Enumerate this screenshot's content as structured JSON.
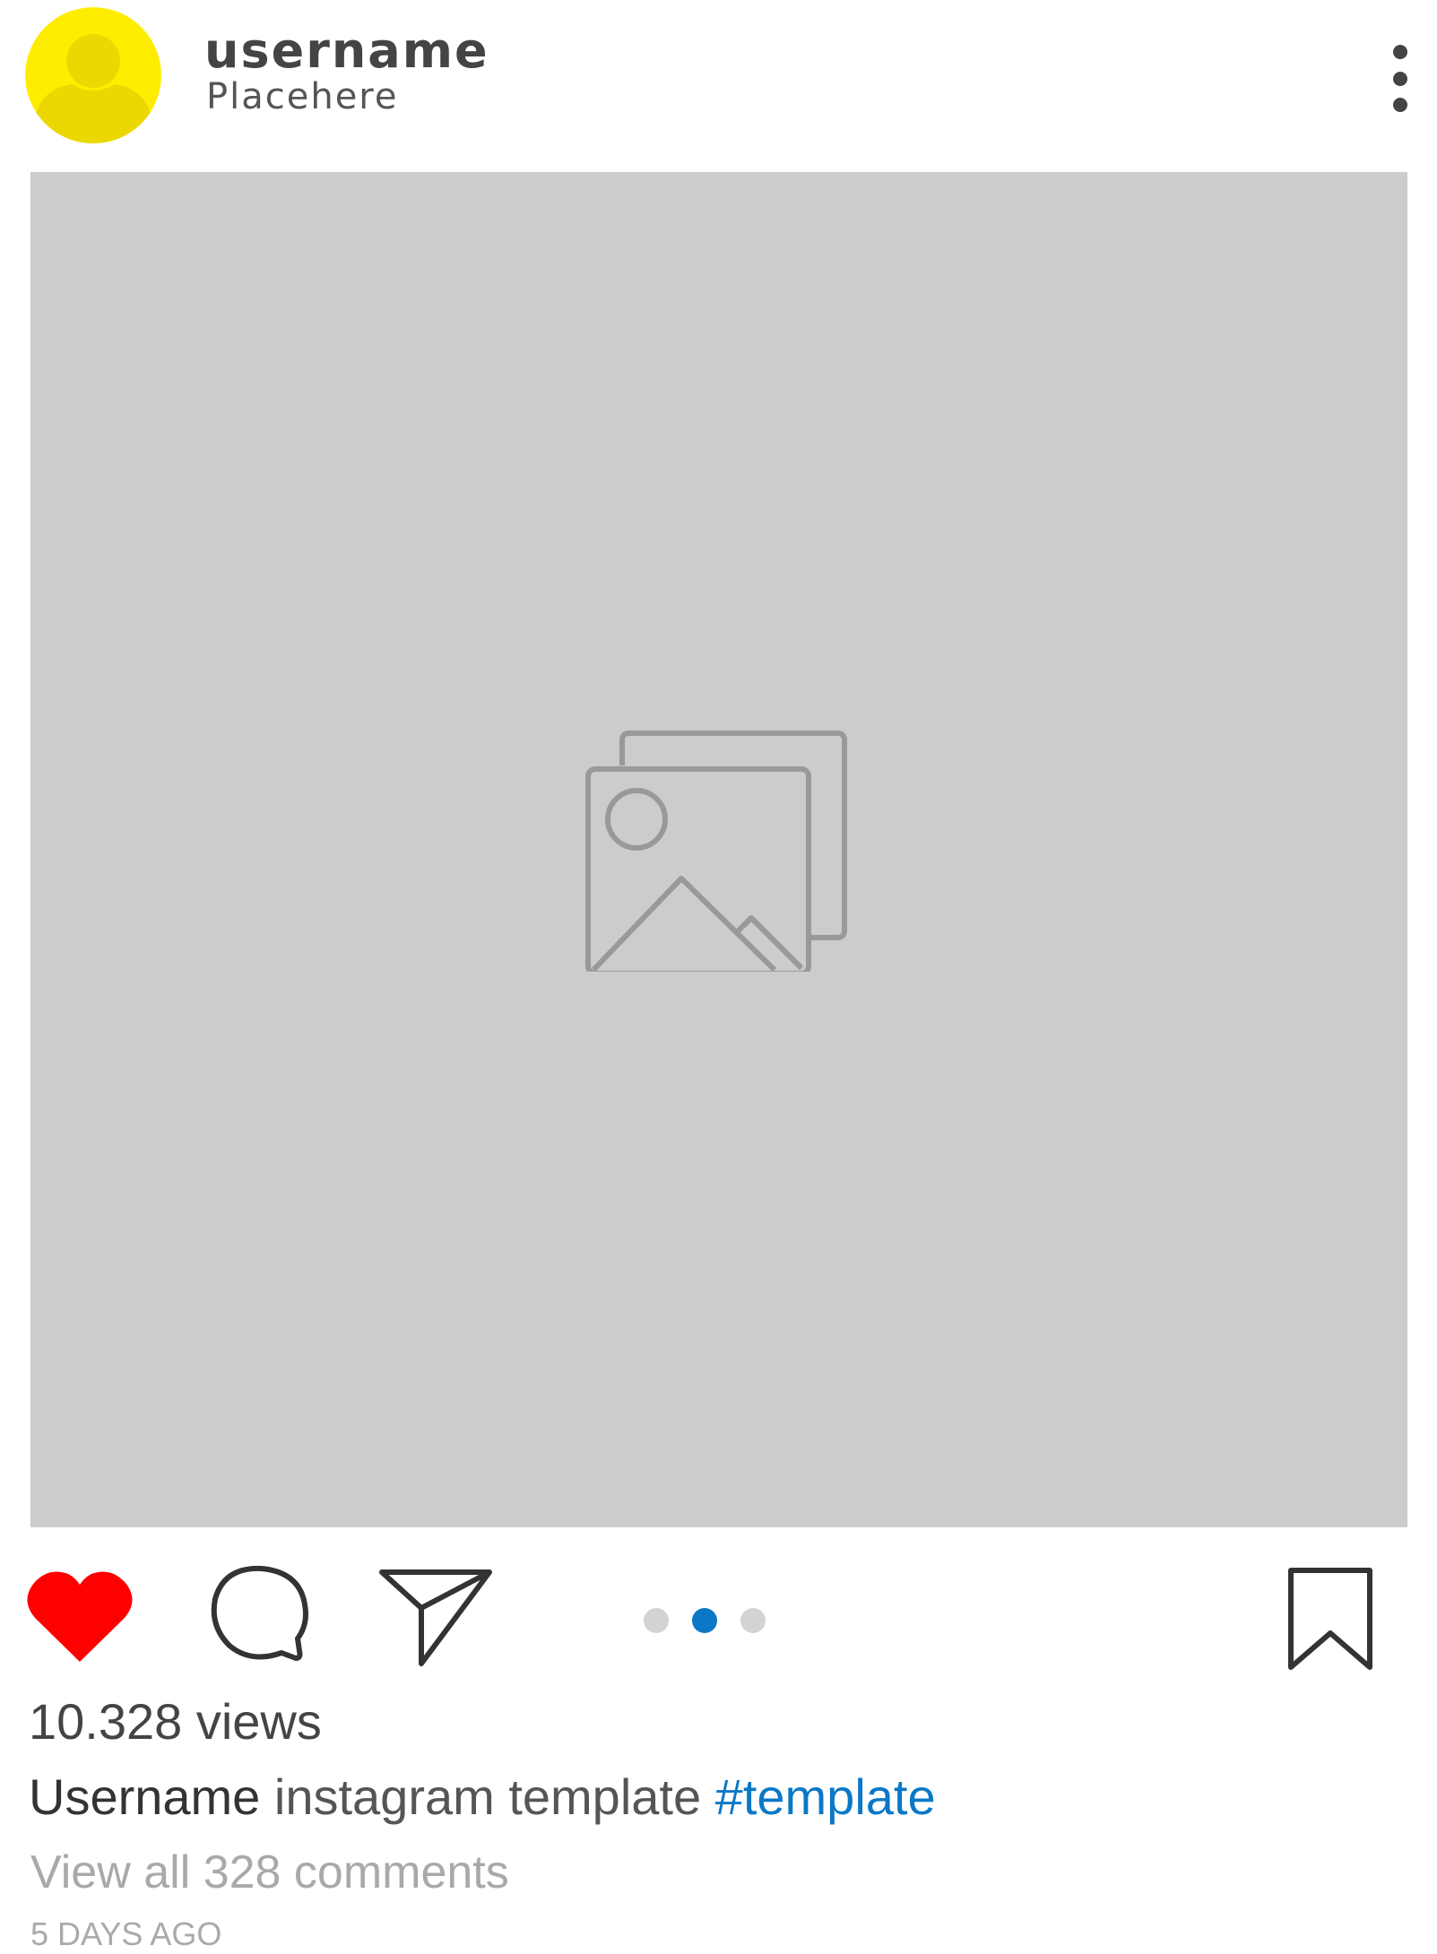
{
  "post": {
    "username": "username",
    "location": "Placehere",
    "views": "10.328 views",
    "caption": {
      "user": "Username",
      "text": "instagram template",
      "hashtag": "#template"
    },
    "comments_link": "View all 328 comments",
    "timestamp": "5 DAYS AGO"
  },
  "carousel": {
    "total": 3,
    "active_index": 1
  },
  "state": {
    "liked": true
  },
  "icons": {
    "avatar": "user-icon",
    "more": "more-vertical-icon",
    "media_placeholder": "image-gallery-icon",
    "like": "heart-icon",
    "comment": "comment-icon",
    "share": "paper-plane-icon",
    "save": "bookmark-icon"
  },
  "colors": {
    "avatar_bg": "#ffed00",
    "avatar_figure": "#ebd800",
    "media_bg": "#cccccc",
    "like_red": "#ff0000",
    "active_dot": "#0a78c7",
    "inactive_dot": "#d3d3d3",
    "hashtag": "#0a78c7",
    "muted_text": "#a9a9a9"
  }
}
